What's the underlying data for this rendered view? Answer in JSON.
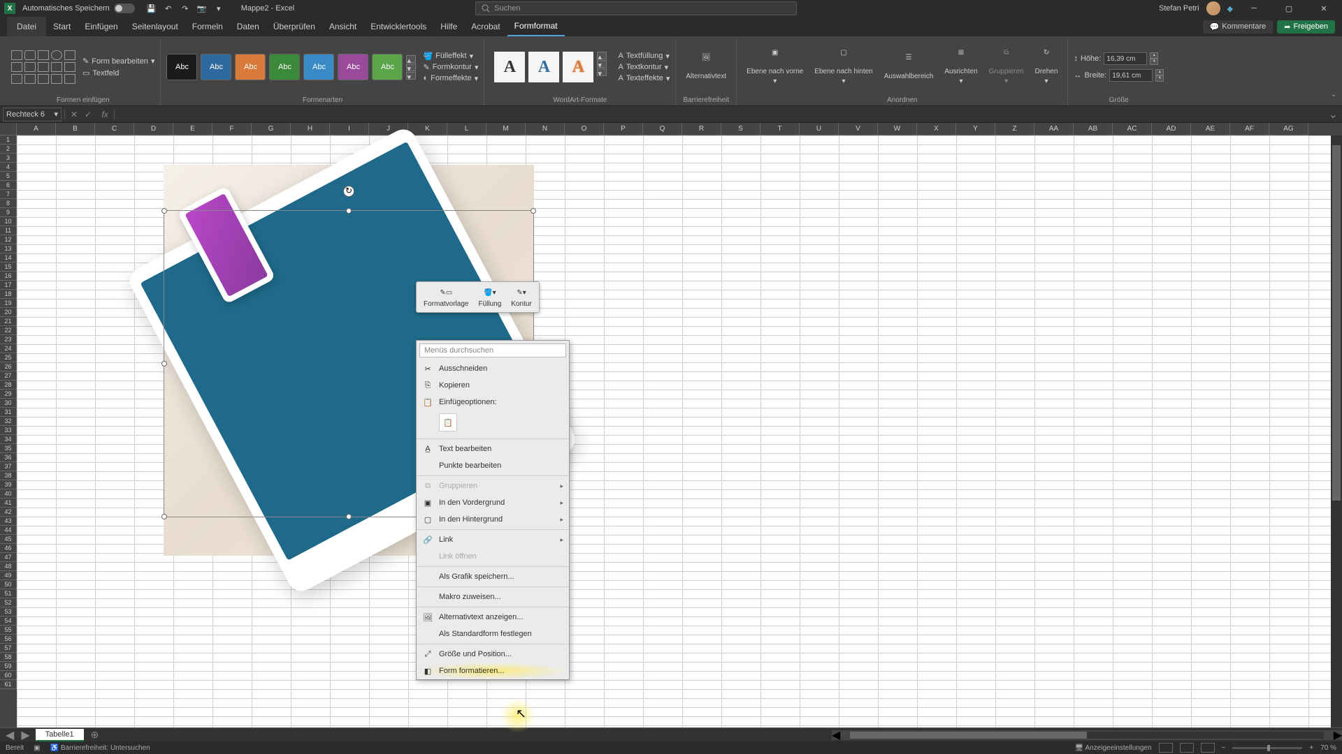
{
  "titlebar": {
    "autosave_label": "Automatisches Speichern",
    "doc_title": "Mappe2 - Excel",
    "search_placeholder": "Suchen",
    "user_name": "Stefan Petri"
  },
  "tabs": {
    "file": "Datei",
    "start": "Start",
    "insert": "Einfügen",
    "page_layout": "Seitenlayout",
    "formulas": "Formeln",
    "data": "Daten",
    "review": "Überprüfen",
    "view": "Ansicht",
    "developer": "Entwicklertools",
    "help": "Hilfe",
    "acrobat": "Acrobat",
    "shape_format": "Formformat",
    "comments": "Kommentare",
    "share": "Freigeben"
  },
  "ribbon": {
    "edit_shape": "Form bearbeiten",
    "textbox": "Textfeld",
    "group_insert_shapes": "Formen einfügen",
    "style_label": "Abc",
    "fill": "Fülleffekt",
    "outline": "Formkontur",
    "effects": "Formeffekte",
    "group_shape_styles": "Formenarten",
    "text_fill": "Textfüllung",
    "text_outline": "Textkontur",
    "text_effects": "Texteffekte",
    "group_wordart": "WordArt-Formate",
    "alt_text": "Alternativtext",
    "group_accessibility": "Barrierefreiheit",
    "bring_forward": "Ebene nach vorne",
    "send_backward": "Ebene nach hinten",
    "selection_pane": "Auswahlbereich",
    "align": "Ausrichten",
    "group_obj": "Gruppieren",
    "rotate": "Drehen",
    "group_arrange": "Anordnen",
    "height_label": "Höhe:",
    "height_val": "16,39 cm",
    "width_label": "Breite:",
    "width_val": "19,61 cm",
    "group_size": "Größe"
  },
  "namebox": "Rechteck 6",
  "columns": [
    "A",
    "B",
    "C",
    "D",
    "E",
    "F",
    "G",
    "H",
    "I",
    "J",
    "K",
    "L",
    "M",
    "N",
    "O",
    "P",
    "Q",
    "R",
    "S",
    "T",
    "U",
    "V",
    "W",
    "X",
    "Y",
    "Z",
    "AA",
    "AB",
    "AC",
    "AD",
    "AE",
    "AF",
    "AG"
  ],
  "mini_toolbar": {
    "style": "Formatvorlage",
    "fill": "Füllung",
    "outline": "Kontur"
  },
  "context_menu": {
    "search": "Menüs durchsuchen",
    "cut": "Ausschneiden",
    "copy": "Kopieren",
    "paste_options": "Einfügeoptionen:",
    "edit_text": "Text bearbeiten",
    "edit_points": "Punkte bearbeiten",
    "group": "Gruppieren",
    "bring_front": "In den Vordergrund",
    "send_back": "In den Hintergrund",
    "link": "Link",
    "open_link": "Link öffnen",
    "save_graphic": "Als Grafik speichern...",
    "assign_macro": "Makro zuweisen...",
    "show_alt_text": "Alternativtext anzeigen...",
    "set_default": "Als Standardform festlegen",
    "size_position": "Größe und Position...",
    "format_shape": "Form formatieren..."
  },
  "sheet": {
    "tab1": "Tabelle1"
  },
  "status": {
    "ready": "Bereit",
    "accessibility": "Barrierefreiheit: Untersuchen",
    "display_settings": "Anzeigeeinstellungen",
    "zoom": "70 %"
  }
}
